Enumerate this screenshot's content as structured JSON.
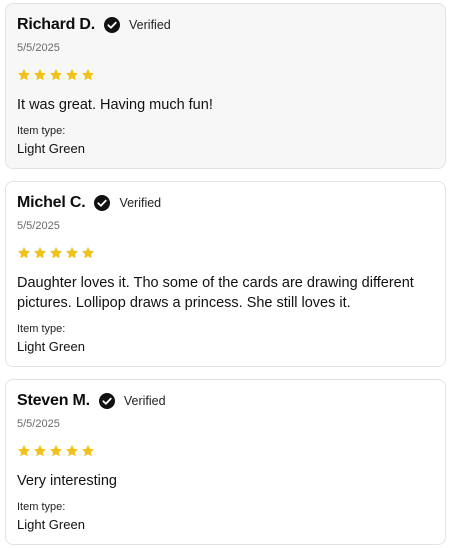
{
  "reviews": [
    {
      "name": "Richard D.",
      "verified_label": "Verified",
      "date": "5/5/2025",
      "rating": 5,
      "text": "It was great. Having much fun!",
      "item_type_label": "Item type:",
      "item_type_value": "Light Green"
    },
    {
      "name": "Michel C.",
      "verified_label": "Verified",
      "date": "5/5/2025",
      "rating": 5,
      "text": "Daughter loves it. Tho some of the cards are drawing different pictures. Lollipop draws a princess. She still loves it.",
      "item_type_label": "Item type:",
      "item_type_value": "Light Green"
    },
    {
      "name": "Steven M.",
      "verified_label": "Verified",
      "date": "5/5/2025",
      "rating": 5,
      "text": "Very interesting",
      "item_type_label": "Item type:",
      "item_type_value": "Light Green"
    }
  ],
  "colors": {
    "star": "#f2c21b",
    "check_badge": "#111111",
    "highlight_card": "#f7f7f7",
    "border": "#e3e3e3"
  },
  "icons": {
    "verified": "check-circle-icon",
    "star": "star-icon"
  }
}
